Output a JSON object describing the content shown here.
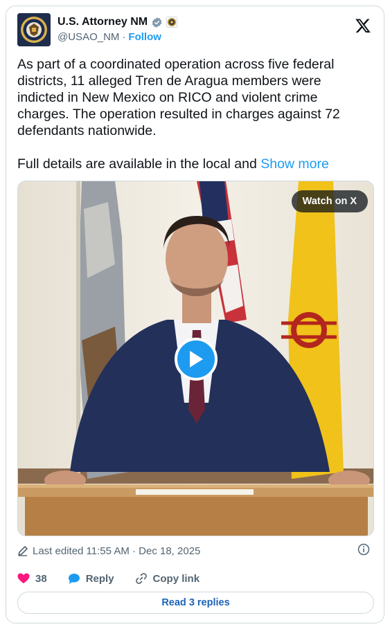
{
  "author": {
    "display_name": "U.S. Attorney NM",
    "handle": "@USAO_NM",
    "separator": "·",
    "follow_label": "Follow"
  },
  "post": {
    "paragraph_1": "As part of a coordinated operation across five federal districts, 11 alleged Tren de Aragua members were indicted in New Mexico on RICO and violent crime charges. The operation resulted in charges against 72 defendants nationwide.",
    "paragraph_2": "Full details are available in the local and ",
    "show_more_label": "Show more"
  },
  "media": {
    "watch_label": "Watch on X"
  },
  "meta": {
    "edited_text": "Last edited 11:55 AM · Dec 18, 2025"
  },
  "actions": {
    "like_count": "38",
    "reply_label": "Reply",
    "copy_link_label": "Copy link"
  },
  "replies_button_label": "Read 3 replies",
  "colors": {
    "accent": "#1d9bf0",
    "like": "#f91880",
    "verified": "#829aab"
  },
  "icons": [
    "seal-avatar-icon",
    "verified-badge-icon",
    "affiliate-badge-icon",
    "x-logo-icon",
    "play-icon",
    "pencil-icon",
    "info-icon",
    "heart-icon",
    "reply-bubble-icon",
    "link-icon"
  ]
}
